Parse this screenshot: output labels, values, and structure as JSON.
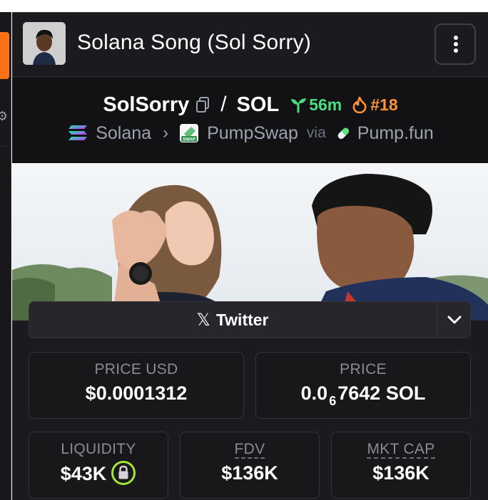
{
  "header": {
    "title": "Solana Song (Sol Sorry)"
  },
  "pair": {
    "base": "SolSorry",
    "separator": "/",
    "quote": "SOL",
    "age": "56m",
    "rank": "#18"
  },
  "chain": {
    "network": "Solana",
    "dex": "PumpSwap",
    "via_label": "via",
    "launchpad": "Pump.fun"
  },
  "socials": {
    "twitter_label": "Twitter"
  },
  "stats": {
    "price_usd": {
      "label": "PRICE USD",
      "value": "$0.0001312"
    },
    "price_native": {
      "label": "PRICE",
      "prefix": "0.0",
      "sub_zeros": "6",
      "digits": "7642",
      "unit": "SOL"
    },
    "liquidity": {
      "label": "LIQUIDITY",
      "value": "$43K"
    },
    "fdv": {
      "label": "FDV",
      "value": "$136K"
    },
    "mkt_cap": {
      "label": "MKT CAP",
      "value": "$136K"
    }
  },
  "colors": {
    "accent_orange": "#f97316",
    "age_green": "#4ade80",
    "rank_orange": "#fb923c",
    "lock_green": "#a3e635",
    "panel_bg": "#1b1b1f"
  },
  "icons": {
    "copy": "copy-icon",
    "age": "sprout-icon",
    "rank": "fire-icon",
    "network": "solana-icon",
    "dex": "pumpswap-icon",
    "launchpad": "pill-icon",
    "twitter": "x-icon",
    "menu": "kebab-icon",
    "liquidity_lock": "lock-icon"
  }
}
